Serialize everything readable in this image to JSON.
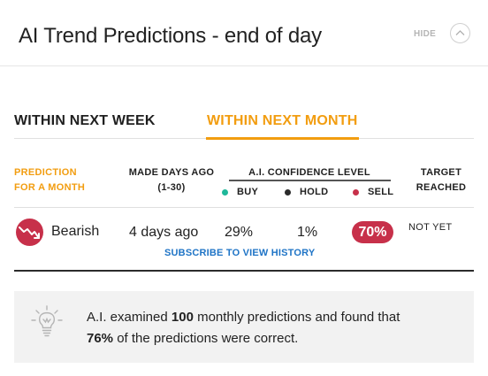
{
  "header": {
    "title": "AI Trend Predictions - end of day",
    "hide_label": "HIDE"
  },
  "tabs": [
    {
      "label": "WITHIN NEXT WEEK",
      "active": false
    },
    {
      "label": "WITHIN NEXT MONTH",
      "active": true
    }
  ],
  "columns": {
    "prediction_line1": "PREDICTION",
    "prediction_line2": "FOR A MONTH",
    "made_line1": "MADE DAYS AGO",
    "made_line2": "(1-30)",
    "confidence": "A.I. CONFIDENCE LEVEL",
    "buy": "BUY",
    "hold": "HOLD",
    "sell": "SELL",
    "target_line1": "TARGET",
    "target_line2": "REACHED"
  },
  "row": {
    "sentiment": "Bearish",
    "made_days_ago": "4 days ago",
    "buy": "29%",
    "hold": "1%",
    "sell": "70%",
    "target_reached": "NOT YET"
  },
  "subscribe_link": "SUBSCRIBE TO VIEW HISTORY",
  "summary": {
    "part1": "A.I. examined ",
    "count": "100",
    "part2": " monthly predictions and found that",
    "percent": "76%",
    "part3": " of the predictions were correct."
  },
  "icons": {
    "sentiment": "bearish-trend-icon",
    "summary": "lightbulb-icon",
    "collapse": "chevron-up-icon"
  },
  "colors": {
    "accent": "#f29d10",
    "sell": "#c7304a",
    "buy": "#1fb89a",
    "hold": "#2b2b2b",
    "link": "#1f74c6"
  }
}
